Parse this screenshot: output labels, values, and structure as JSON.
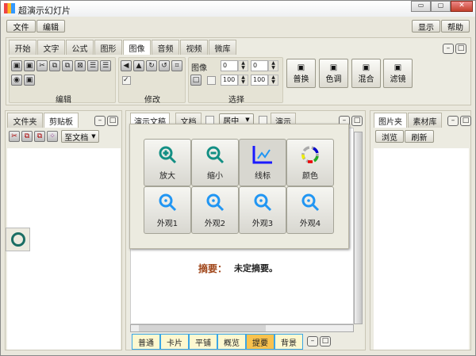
{
  "window": {
    "title": "超演示幻灯片",
    "controls": [
      "minimize",
      "maximize",
      "close"
    ]
  },
  "menu": {
    "left": [
      "文件",
      "编辑"
    ],
    "right": [
      "显示",
      "帮助"
    ]
  },
  "ribbon_tabs": [
    "开始",
    "文字",
    "公式",
    "图形",
    "图像",
    "音频",
    "视频",
    "微库"
  ],
  "active_ribbon_tab": "图像",
  "ribbon": {
    "edit_group": "编辑",
    "modify_group": "修改",
    "select_group": "选择",
    "select_label": "图像",
    "spin_values": [
      "0",
      "0",
      "100",
      "100"
    ],
    "buttons": [
      "普换",
      "色调",
      "混合",
      "滤镜"
    ]
  },
  "left_panel": {
    "tabs": [
      "文件夹",
      "剪贴板"
    ],
    "active": "剪贴板",
    "to_doc": "至文档"
  },
  "center_panel": {
    "tabs": [
      "演示文稿",
      "文档"
    ],
    "align": "居中",
    "present": "演示"
  },
  "popup": {
    "buttons": [
      "放大",
      "缩小",
      "线标",
      "颜色",
      "外观1",
      "外观2",
      "外观3",
      "外观4"
    ]
  },
  "document": {
    "summary_label": "摘要：",
    "summary_text": "未定摘要。"
  },
  "bottom_tabs": [
    "普通",
    "卡片",
    "平铺",
    "概览",
    "提要",
    "背景"
  ],
  "active_bottom_tab": "提要",
  "right_panel": {
    "tabs": [
      "图片夹",
      "素材库"
    ],
    "active": "图片夹",
    "buttons": [
      "浏览",
      "刷新"
    ]
  },
  "colors": {
    "accent_orange": "#f8c24e",
    "teal_icon": "#138f84",
    "blue_icon": "#2196f3",
    "summary_label": "#a0461a"
  }
}
